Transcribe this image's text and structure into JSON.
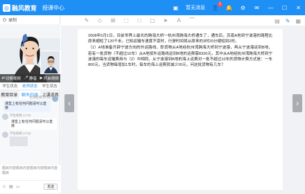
{
  "titlebar": {
    "brand": "融风教育",
    "app_name": "授课中心",
    "status_text": "暂无消息",
    "notify_count": "1",
    "icons": [
      "status-icon",
      "user-icon",
      "bell-icon",
      "settings-icon",
      "message-icon",
      "minimize-icon",
      "maximize-icon",
      "close-icon"
    ]
  },
  "left": {
    "record_label": "录制",
    "controls": {
      "switch_view": "切换视频",
      "mute": "静音",
      "camera": "开启视频"
    },
    "tabs": [
      "学生状态",
      "老师状态",
      "学生状态"
    ],
    "subtabs": [
      "教案目录",
      "聊天内容",
      "上课道具"
    ],
    "messages": [
      {
        "name": "老师昵称 17:02",
        "text": "课堂上有任何问题请可以直接",
        "side": "right"
      },
      {
        "name": "学生昵称 17:02",
        "text": "课堂上有任何问题请可以直接",
        "side": "left"
      },
      {
        "name": "学生昵称 17:02",
        "text": "",
        "side": "left"
      }
    ],
    "input_placeholder": "题目内容题目内容题目内容题目内容题目",
    "send_label": "发送"
  },
  "slide": {
    "paragraphs": [
      "2008年5月1日，目前世界上最长的跨海大桥一杭州湾跨海大桥通车了，通车后，苏南A地到宁波港的路程比原来缩短了120千米，已知运输车速度不变时，行驶时间将从原来的3时20分缩短到2时。",
      "（1）A地准备开辟宁波方向的外运路线，即货物从A地经杭州湾跨海大桥到宁波港，再从宁波港运到B地，若有一批货物（不超过10车）从A地按外运路线运到B地的运费需8320元，其中从A地经杭州湾跨海大桥到宁波港的每车运输费用与（2）中相同，从宁波港到B地的海上运费对一批不超过10车的货物计费方式是：一车800元，当货物每增加1车时，每车的海上运费就减少20元，问这批货物有几车？"
    ]
  }
}
